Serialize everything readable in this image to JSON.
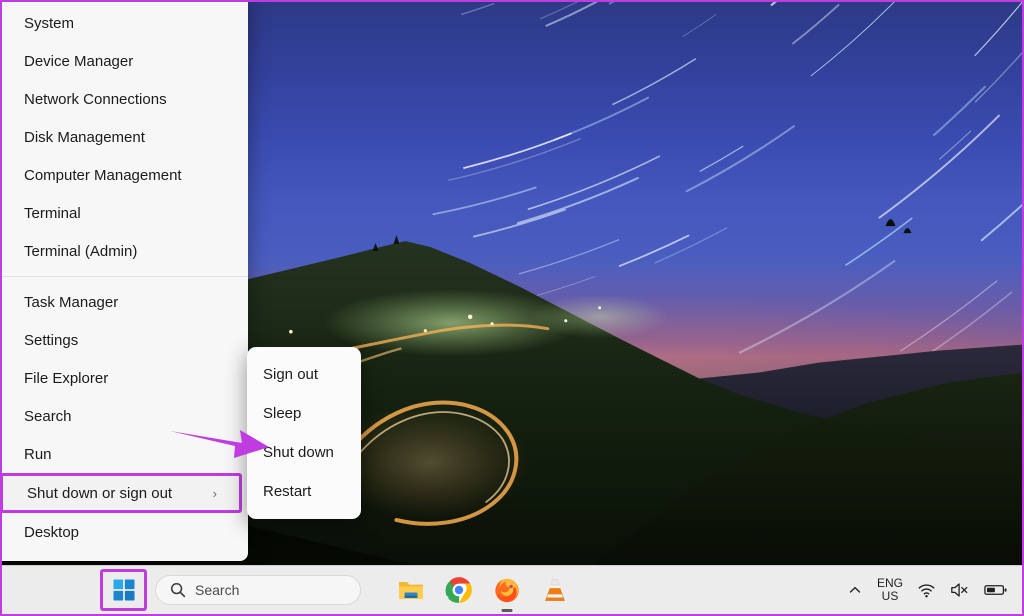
{
  "desktop": {
    "wallpaper_description": "night sky star trails over forested mountain ridge with winding illuminated road",
    "wallpaper_colors": {
      "sky_top": "#2c3a86",
      "sky_mid": "#4a5ec0",
      "horizon_glow": "#a5657f",
      "land": "#0b0f0b"
    }
  },
  "annotations": {
    "highlight_color": "#bf3ce0",
    "arrow_color": "#bf3ce0",
    "arrow_name": "pointer-arrow"
  },
  "context_menu": {
    "name": "win-x-power-user-menu",
    "groups": [
      {
        "items": [
          {
            "label": "System",
            "name": "menu-item-system",
            "has_submenu": false
          },
          {
            "label": "Device Manager",
            "name": "menu-item-device-manager",
            "has_submenu": false
          },
          {
            "label": "Network Connections",
            "name": "menu-item-network-connections",
            "has_submenu": false
          },
          {
            "label": "Disk Management",
            "name": "menu-item-disk-management",
            "has_submenu": false
          },
          {
            "label": "Computer Management",
            "name": "menu-item-computer-management",
            "has_submenu": false
          },
          {
            "label": "Terminal",
            "name": "menu-item-terminal",
            "has_submenu": false
          },
          {
            "label": "Terminal (Admin)",
            "name": "menu-item-terminal-admin",
            "has_submenu": false
          }
        ]
      },
      {
        "items": [
          {
            "label": "Task Manager",
            "name": "menu-item-task-manager",
            "has_submenu": false
          },
          {
            "label": "Settings",
            "name": "menu-item-settings",
            "has_submenu": false
          },
          {
            "label": "File Explorer",
            "name": "menu-item-file-explorer",
            "has_submenu": false
          },
          {
            "label": "Search",
            "name": "menu-item-search",
            "has_submenu": false
          },
          {
            "label": "Run",
            "name": "menu-item-run",
            "has_submenu": false
          },
          {
            "label": "Shut down or sign out",
            "name": "menu-item-shutdown-signout",
            "has_submenu": true,
            "chevron": "›",
            "highlighted": true
          },
          {
            "label": "Desktop",
            "name": "menu-item-desktop",
            "has_submenu": false
          }
        ]
      }
    ]
  },
  "submenu": {
    "name": "shutdown-or-signout-submenu",
    "parent": "Shut down or sign out",
    "items": [
      {
        "label": "Sign out",
        "name": "submenu-item-sign-out"
      },
      {
        "label": "Sleep",
        "name": "submenu-item-sleep"
      },
      {
        "label": "Shut down",
        "name": "submenu-item-shut-down",
        "pointed_at": true
      },
      {
        "label": "Restart",
        "name": "submenu-item-restart"
      }
    ]
  },
  "taskbar": {
    "start_button": {
      "name": "start-button",
      "icon": "windows-logo-icon",
      "highlighted": true
    },
    "search": {
      "placeholder": "Search",
      "icon": "search-icon"
    },
    "apps": [
      {
        "name": "file-explorer-icon",
        "label": "File Explorer",
        "running": false
      },
      {
        "name": "google-chrome-icon",
        "label": "Google Chrome",
        "running": false
      },
      {
        "name": "firefox-icon",
        "label": "Mozilla Firefox",
        "running": true
      },
      {
        "name": "vlc-icon",
        "label": "VLC media player",
        "running": false
      }
    ],
    "tray": {
      "overflow_icon": "chevron-up-icon",
      "language_line1": "ENG",
      "language_line2": "US",
      "wifi_icon": "wifi-icon",
      "volume_icon": "speaker-muted-icon",
      "battery_icon": "battery-icon"
    }
  }
}
